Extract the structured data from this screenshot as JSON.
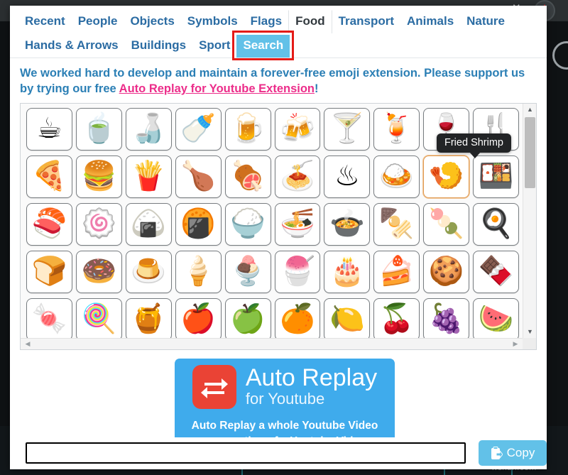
{
  "browser": {
    "back_icon": "‹",
    "close_icon": "✕",
    "watermark": "wsxdn.com"
  },
  "tabs": {
    "row1": [
      {
        "label": "Recent",
        "state": "normal"
      },
      {
        "label": "People",
        "state": "normal"
      },
      {
        "label": "Objects",
        "state": "normal"
      },
      {
        "label": "Symbols",
        "state": "normal"
      },
      {
        "label": "Flags",
        "state": "normal"
      },
      {
        "label": "Food",
        "state": "active"
      },
      {
        "label": "Transport",
        "state": "normal"
      },
      {
        "label": "Animals",
        "state": "normal"
      },
      {
        "label": "Nature",
        "state": "normal"
      }
    ],
    "row2": [
      {
        "label": "Hands & Arrows",
        "state": "normal"
      },
      {
        "label": "Buildings",
        "state": "normal"
      },
      {
        "label": "Sport",
        "state": "normal"
      },
      {
        "label": "Search",
        "state": "selected"
      }
    ],
    "highlight_color": "#e41b17",
    "selected_color": "#62c1e8",
    "link_color": "#2b6ca3"
  },
  "promo": {
    "text_before": "We worked hard to develop and maintain a forever-free emoji extension. Please support us by trying our free ",
    "link_text": "Auto Replay for Youtube Extension",
    "text_after": "!",
    "text_color": "#2b7fb5",
    "link_color": "#ec2d8a"
  },
  "tooltip": {
    "label": "Fried Shrimp",
    "background": "#222426"
  },
  "emoji_grid": {
    "hovered_index": 18,
    "rows": [
      [
        {
          "name": "hot-beverage",
          "glyph": "☕"
        },
        {
          "name": "teacup-without-handle",
          "glyph": "🍵"
        },
        {
          "name": "sake",
          "glyph": "🍶"
        },
        {
          "name": "baby-bottle",
          "glyph": "🍼"
        },
        {
          "name": "beer-mug",
          "glyph": "🍺"
        },
        {
          "name": "clinking-beer-mugs",
          "glyph": "🍻"
        },
        {
          "name": "cocktail-glass",
          "glyph": "🍸"
        },
        {
          "name": "tropical-drink",
          "glyph": "🍹"
        },
        {
          "name": "wine-glass",
          "glyph": "🍷"
        },
        {
          "name": "fork-and-knife",
          "glyph": "🍴"
        }
      ],
      [
        {
          "name": "pizza",
          "glyph": "🍕"
        },
        {
          "name": "hamburger",
          "glyph": "🍔"
        },
        {
          "name": "french-fries",
          "glyph": "🍟"
        },
        {
          "name": "poultry-leg",
          "glyph": "🍗"
        },
        {
          "name": "cut-of-meat",
          "glyph": "🍖"
        },
        {
          "name": "spaghetti",
          "glyph": "🍝"
        },
        {
          "name": "steaming-bowl",
          "glyph": "♨"
        },
        {
          "name": "curry-rice",
          "glyph": "🍛"
        },
        {
          "name": "fried-shrimp",
          "glyph": "🍤"
        },
        {
          "name": "bento-box",
          "glyph": "🍱"
        }
      ],
      [
        {
          "name": "sushi",
          "glyph": "🍣"
        },
        {
          "name": "fish-cake",
          "glyph": "🍥"
        },
        {
          "name": "rice-ball",
          "glyph": "🍙"
        },
        {
          "name": "rice-cracker",
          "glyph": "🍘"
        },
        {
          "name": "cooked-rice",
          "glyph": "🍚"
        },
        {
          "name": "steaming-noodles",
          "glyph": "🍜"
        },
        {
          "name": "pot-of-food",
          "glyph": "🍲"
        },
        {
          "name": "oden",
          "glyph": "🍢"
        },
        {
          "name": "dango",
          "glyph": "🍡"
        },
        {
          "name": "cooking-egg",
          "glyph": "🍳"
        }
      ],
      [
        {
          "name": "bread",
          "glyph": "🍞"
        },
        {
          "name": "doughnut",
          "glyph": "🍩"
        },
        {
          "name": "custard",
          "glyph": "🍮"
        },
        {
          "name": "soft-ice-cream",
          "glyph": "🍦"
        },
        {
          "name": "ice-cream",
          "glyph": "🍨"
        },
        {
          "name": "shaved-ice",
          "glyph": "🍧"
        },
        {
          "name": "birthday-cake",
          "glyph": "🎂"
        },
        {
          "name": "shortcake",
          "glyph": "🍰"
        },
        {
          "name": "cookie",
          "glyph": "🍪"
        },
        {
          "name": "chocolate-bar",
          "glyph": "🍫"
        }
      ],
      [
        {
          "name": "candy",
          "glyph": "🍬"
        },
        {
          "name": "lollipop",
          "glyph": "🍭"
        },
        {
          "name": "honey-pot",
          "glyph": "🍯"
        },
        {
          "name": "red-apple",
          "glyph": "🍎"
        },
        {
          "name": "green-apple",
          "glyph": "🍏"
        },
        {
          "name": "tangerine",
          "glyph": "🍊"
        },
        {
          "name": "lemon",
          "glyph": "🍋"
        },
        {
          "name": "cherries",
          "glyph": "🍒"
        },
        {
          "name": "grapes",
          "glyph": "🍇"
        },
        {
          "name": "watermelon",
          "glyph": "🍉"
        }
      ]
    ],
    "scrollbar": {
      "up_arrow": "▲",
      "down_arrow": "▼",
      "left_arrow": "◀",
      "right_arrow": "▶"
    }
  },
  "ad": {
    "title": "Auto Replay",
    "subtitle": "for Youtube",
    "desc_line1": "Auto Replay a whole Youtube Video",
    "desc_line2": "or a portion of a Youtube Video",
    "background": "#3fabec",
    "logo_background": "#ea4335",
    "logo_icon": "repeat-icon"
  },
  "bottom": {
    "input_value": "",
    "input_placeholder": "",
    "copy_label": "Copy",
    "copy_icon": "paste-clipboard-icon",
    "copy_background": "#62c1e8"
  }
}
